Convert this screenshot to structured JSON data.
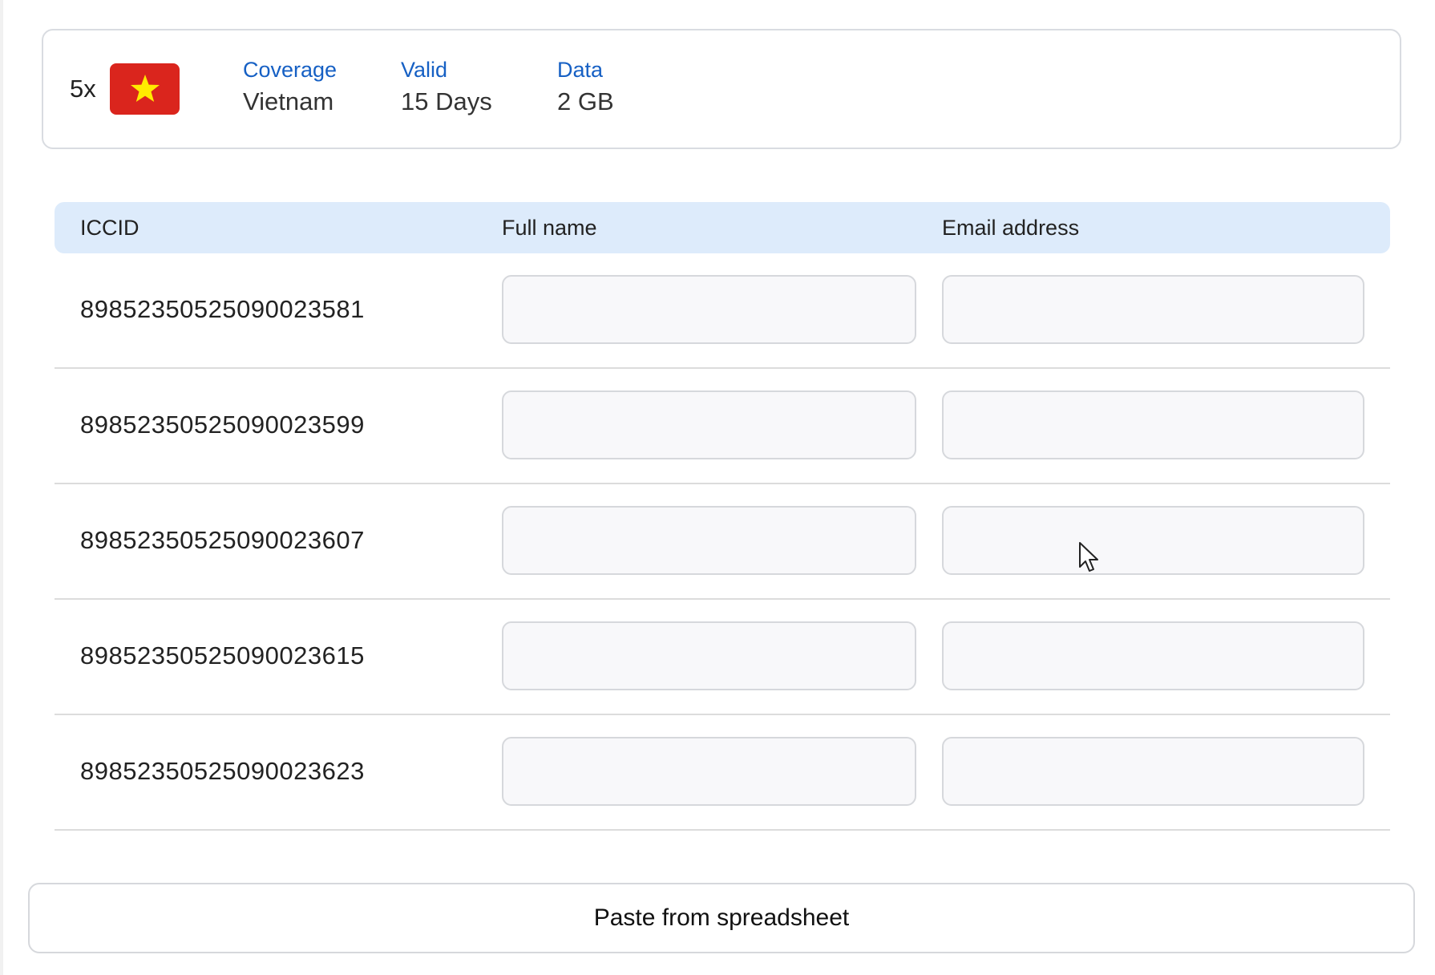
{
  "summary": {
    "quantity": "5x",
    "flag_icon": "vietnam-flag-icon",
    "flag_colors": {
      "background": "#da251d",
      "star": "#ffeb00"
    },
    "coverage_label": "Coverage",
    "coverage_value": "Vietnam",
    "valid_label": "Valid",
    "valid_value": "15 Days",
    "data_label": "Data",
    "data_value": "2 GB"
  },
  "table": {
    "headers": [
      "ICCID",
      "Full name",
      "Email address"
    ],
    "rows": [
      {
        "iccid": "89852350525090023581",
        "full_name": "",
        "email": ""
      },
      {
        "iccid": "89852350525090023599",
        "full_name": "",
        "email": ""
      },
      {
        "iccid": "89852350525090023607",
        "full_name": "",
        "email": ""
      },
      {
        "iccid": "89852350525090023615",
        "full_name": "",
        "email": ""
      },
      {
        "iccid": "89852350525090023623",
        "full_name": "",
        "email": ""
      }
    ]
  },
  "paste_button_label": "Paste from spreadsheet",
  "colors": {
    "accent_label": "#1660c4",
    "header_background": "#ddebfb"
  }
}
